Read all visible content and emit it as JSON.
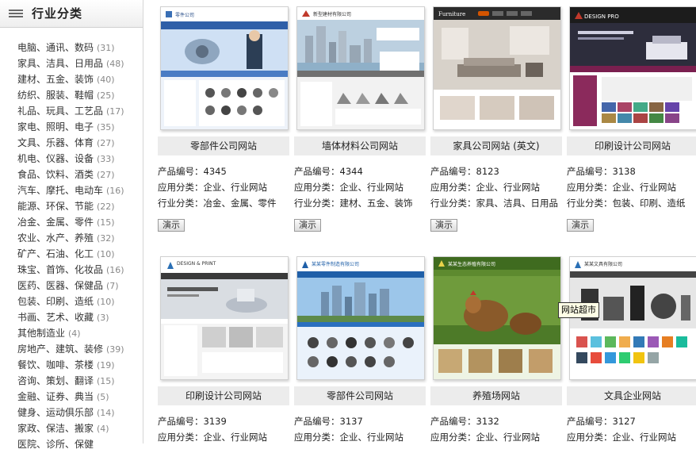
{
  "sidebar": {
    "title": "行业分类",
    "categories": [
      {
        "label": "电脑、通讯、数码",
        "count": "(31)"
      },
      {
        "label": "家具、洁具、日用品",
        "count": "(48)"
      },
      {
        "label": "建材、五金、装饰",
        "count": "(40)"
      },
      {
        "label": "纺织、服装、鞋帽",
        "count": "(25)"
      },
      {
        "label": "礼品、玩具、工艺品",
        "count": "(17)"
      },
      {
        "label": "家电、照明、电子",
        "count": "(35)"
      },
      {
        "label": "文具、乐器、体育",
        "count": "(27)"
      },
      {
        "label": "机电、仪器、设备",
        "count": "(33)"
      },
      {
        "label": "食品、饮料、酒类",
        "count": "(27)"
      },
      {
        "label": "汽车、摩托、电动车",
        "count": "(16)"
      },
      {
        "label": "能源、环保、节能",
        "count": "(22)"
      },
      {
        "label": "冶金、金属、零件",
        "count": "(15)"
      },
      {
        "label": "农业、水产、养殖",
        "count": "(32)"
      },
      {
        "label": "矿产、石油、化工",
        "count": "(10)"
      },
      {
        "label": "珠宝、首饰、化妆品",
        "count": "(16)"
      },
      {
        "label": "医药、医器、保健品",
        "count": "(7)"
      },
      {
        "label": "包装、印刷、造纸",
        "count": "(10)"
      },
      {
        "label": "书画、艺术、收藏",
        "count": "(3)"
      },
      {
        "label": "其他制造业",
        "count": "(4)"
      },
      {
        "label": "房地产、建筑、装修",
        "count": "(39)"
      },
      {
        "label": "餐饮、咖啡、茶楼",
        "count": "(19)"
      },
      {
        "label": "咨询、策划、翻译",
        "count": "(15)"
      },
      {
        "label": "金融、证券、典当",
        "count": "(5)"
      },
      {
        "label": "健身、运动俱乐部",
        "count": "(14)"
      },
      {
        "label": "家政、保洁、搬家",
        "count": "(4)"
      },
      {
        "label": "医院、诊所、保健",
        "count": ""
      }
    ]
  },
  "products": [
    {
      "title": "零部件公司网站",
      "code_label": "产品编号：",
      "code": "4345",
      "app_label": "应用分类：",
      "app": "企业、行业网站",
      "ind_label": "行业分类：",
      "ind": "冶金、金属、零件",
      "demo": "演示",
      "thumb_text": "零件公司"
    },
    {
      "title": "墙体材料公司网站",
      "code_label": "产品编号：",
      "code": "4344",
      "app_label": "应用分类：",
      "app": "企业、行业网站",
      "ind_label": "行业分类：",
      "ind": "建材、五金、装饰",
      "demo": "演示",
      "thumb_text": "新型建材有限公司"
    },
    {
      "title": "家具公司网站 (英文)",
      "code_label": "产品编号：",
      "code": "8123",
      "app_label": "应用分类：",
      "app": "企业、行业网站",
      "ind_label": "行业分类：",
      "ind": "家具、洁具、日用品",
      "demo": "演示",
      "thumb_text": "Furniture"
    },
    {
      "title": "印刷设计公司网站",
      "code_label": "产品编号：",
      "code": "3138",
      "app_label": "应用分类：",
      "app": "企业、行业网站",
      "ind_label": "行业分类：",
      "ind": "包装、印刷、造纸",
      "demo": "演示",
      "thumb_text": "DESIGN PRO"
    },
    {
      "title": "印刷设计公司网站",
      "code_label": "产品编号：",
      "code": "3139",
      "app_label": "应用分类：",
      "app": "企业、行业网站",
      "thumb_text": "DESIGN & PRINT"
    },
    {
      "title": "零部件公司网站",
      "code_label": "产品编号：",
      "code": "3137",
      "app_label": "应用分类：",
      "app": "企业、行业网站",
      "thumb_text": "某某零件制造有限公司"
    },
    {
      "title": "养殖场网站",
      "code_label": "产品编号：",
      "code": "3132",
      "app_label": "应用分类：",
      "app": "企业、行业网站",
      "thumb_text": "某某生态养殖有限公司"
    },
    {
      "title": "文具企业网站",
      "code_label": "产品编号：",
      "code": "3127",
      "app_label": "应用分类：",
      "app": "企业、行业网站",
      "thumb_text": "某某文具有限公司"
    }
  ],
  "tooltip": "网站超市",
  "colors": {
    "card_title_bg": "#ececec",
    "border": "#d0d0d0"
  }
}
